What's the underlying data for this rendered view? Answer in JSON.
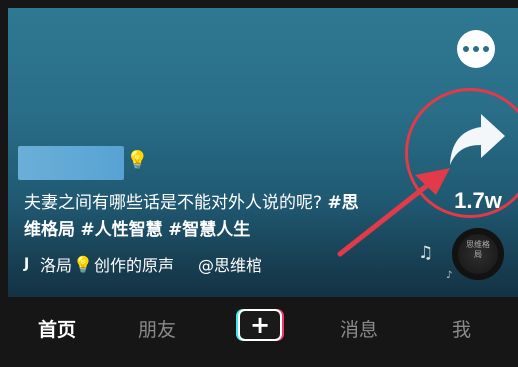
{
  "video": {
    "share_count": "1.7w",
    "caption_line1": "夫妻之间有哪些话是不能对外人说的呢?",
    "caption_tag1": "#思",
    "caption_line2_tag1": "维格局",
    "caption_line2_tag2": "#人性智慧",
    "caption_line2_tag3": "#智慧人生",
    "sound_prefix": "J",
    "sound_part1": "洛局",
    "sound_part2": "创作的原声",
    "sound_author": "@思维棺",
    "disc_label": "思维格局"
  },
  "icons": {
    "comment": "comment-icon",
    "share": "share-icon",
    "music": "music-note-icon",
    "bulb": "lightbulb-icon",
    "tiktok": "tiktok-logo-icon"
  },
  "nav": {
    "home": "首页",
    "friends": "朋友",
    "create": "+",
    "messages": "消息",
    "me": "我"
  },
  "colors": {
    "highlight": "#e23a48",
    "accent_cyan": "#3be8f0",
    "accent_red": "#f2386b"
  }
}
